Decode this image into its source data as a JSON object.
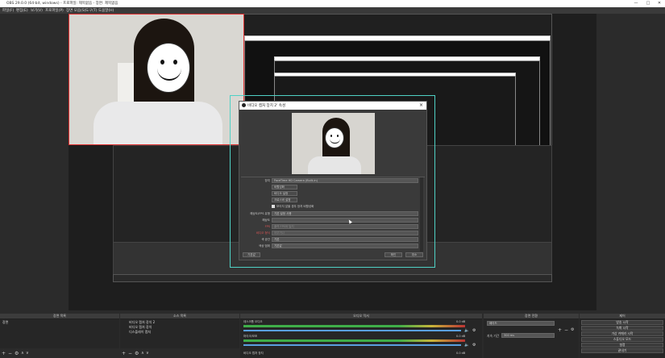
{
  "window": {
    "title": "OBS 29.0.0 (64-bit, windows) - 프로파일: 제목없음 - 장면: 제목없음",
    "controls": [
      "—",
      "□",
      "✕"
    ]
  },
  "menu": [
    "파일(F)",
    "편집(E)",
    "보기(V)",
    "프로파일(P)",
    "장면 모음(S)",
    "도구(T)",
    "도움말(H)"
  ],
  "dialog": {
    "title": "비디오 캡처 장치 2' 속성",
    "device_label": "장치",
    "device_value": "FaceTime HD Camera (Built-in)",
    "deactivate_button": "비활성화",
    "configure_video_button": "비디오 설정",
    "configure_crossbar_button": "크로스바 설정",
    "deactivate_on_hide": "보이지 않을 경우 장치 비활성화",
    "res_fps_type_label": "해상도/FPS 유형",
    "res_fps_type_value": "기본 설정 사용",
    "resolution_label": "해상도",
    "fps_label": "FPS",
    "fps_value": "출력 FPS와 일치",
    "video_format_label": "비디오 형식",
    "video_format_value": "아무거나",
    "color_space_label": "색 공간",
    "color_space_value": "기본",
    "color_range_label": "색상 범위",
    "color_range_value": "기본값",
    "defaults_button": "기본값",
    "ok_button": "확인",
    "cancel_button": "취소"
  },
  "docks": {
    "scenes": {
      "title": "장면 목록",
      "items": [
        "장면"
      ]
    },
    "sources": {
      "title": "소스 목록",
      "items": [
        "비디오 캡처 장치 2",
        "비디오 캡처 장치",
        "디스플레이 캡처"
      ]
    },
    "mixer": {
      "title": "오디오 믹서",
      "channels": [
        {
          "name": "데스크톱 오디오",
          "level": "0.0 dB"
        },
        {
          "name": "마이크/보조",
          "level": "0.0 dB"
        },
        {
          "name": "비디오 캡처 장치",
          "level": "0.0 dB"
        }
      ]
    },
    "transitions": {
      "title": "장면 전환",
      "type": "페이드",
      "duration_label": "지속 기간",
      "duration_value": "300 ms"
    },
    "controls": {
      "title": "제어",
      "buttons": [
        "방송 시작",
        "녹화 시작",
        "가상 카메라 시작",
        "스튜디오 모드",
        "설정",
        "끝내기"
      ]
    }
  },
  "colors": {
    "selection": "#4fd1c5",
    "source_outline": "#e03030",
    "meter_green": "#3fae49",
    "meter_yellow": "#c9b53a"
  }
}
